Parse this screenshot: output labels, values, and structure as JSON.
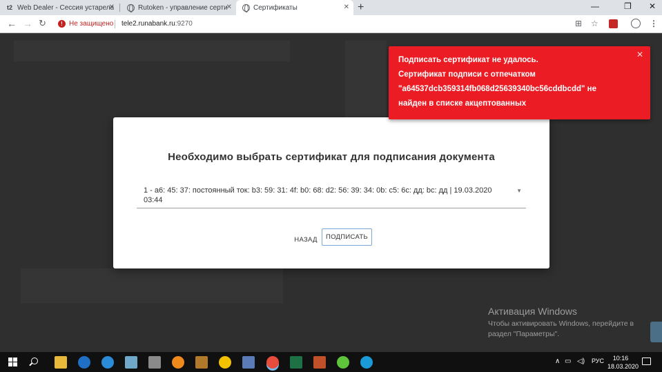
{
  "tabs": [
    {
      "title": "Web Dealer - Сессия устарела",
      "favicon": "t2"
    },
    {
      "title": "Rutoken - управление сертифи...",
      "favicon": "globe-icon"
    },
    {
      "title": "Сертификаты",
      "favicon": "globe-icon"
    }
  ],
  "address_bar": {
    "security_label": "Не защищено",
    "url_host": "tele2.runabank.ru",
    "url_port": ":9270"
  },
  "dialog": {
    "title": "Необходимо выбрать сертификат для подписания документа",
    "selected_certificate": "1 - a6: 45: 37: постоянный ток: b3: 59: 31: 4f: b0: 68: d2: 56: 39: 34: 0b: c5: 6c: дд: bc: дд | 19.03.2020 03:44",
    "back_label": "НАЗАД",
    "sign_label": "ПОДПИСАТЬ"
  },
  "toast": {
    "line1": "Подписать сертификат не удалось.",
    "line2": "Сертификат подписи с отпечатком",
    "line3": "\"a64537dcb359314fb068d25639340bc56cddbcdd\" не",
    "line4": "найден в списке акцептованных",
    "color": "#ec1c24"
  },
  "watermark": {
    "title": "Активация Windows",
    "line1": "Чтобы активировать Windows, перейдите в",
    "line2": "раздел \"Параметры\"."
  },
  "taskbar": {
    "language": "РУС",
    "time": "10:16",
    "date": "18.03.2020"
  }
}
